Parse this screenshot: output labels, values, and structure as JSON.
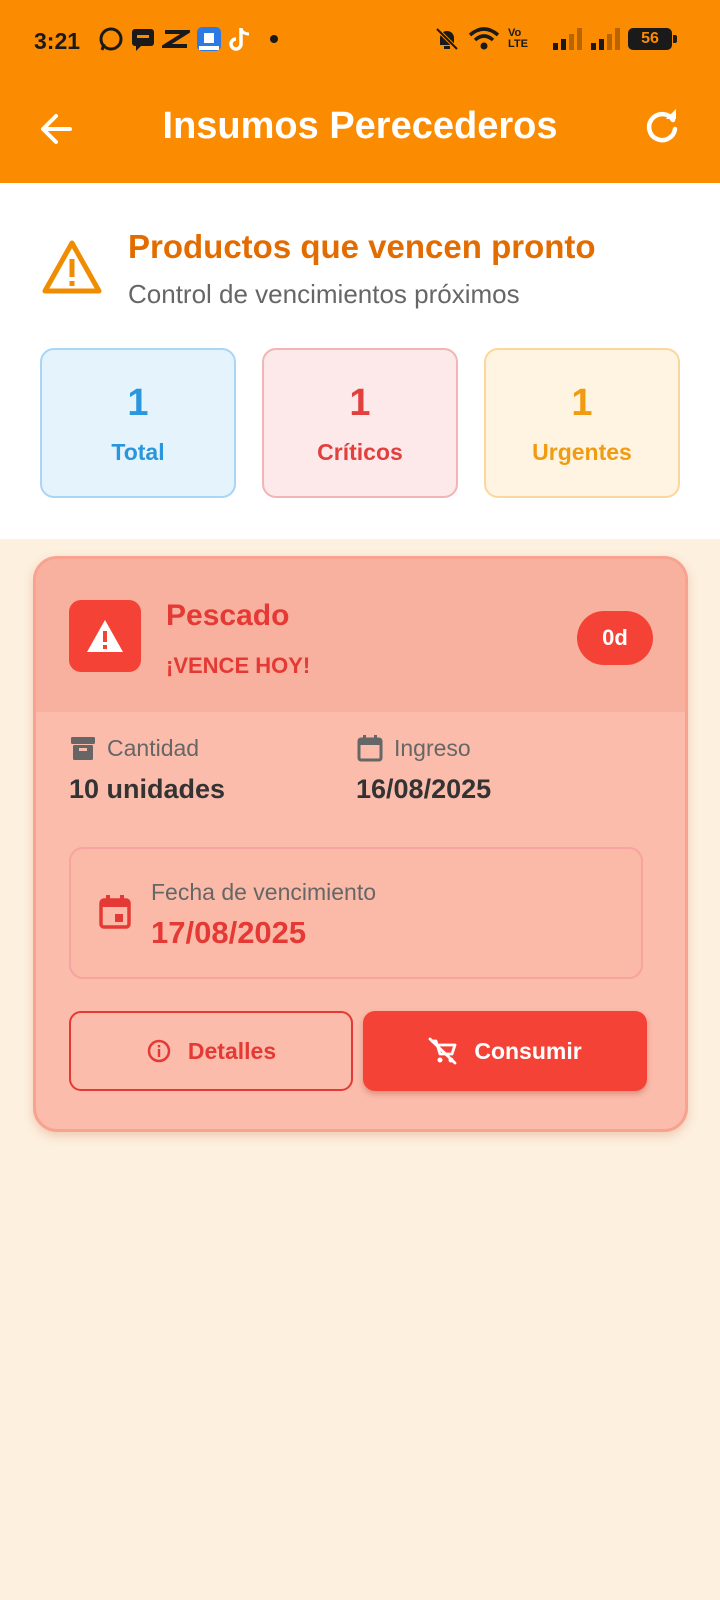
{
  "status_bar": {
    "time": "3:21",
    "network_label": "Vo LTE",
    "battery": "56",
    "app_icons": [
      "whatsapp-icon",
      "messenger-icon",
      "capcut-icon",
      "app-icon",
      "tiktok-icon"
    ]
  },
  "appbar": {
    "title": "Insumos Perecederos",
    "back_icon": "arrow-left-icon",
    "refresh_icon": "refresh-icon"
  },
  "summary": {
    "title": "Productos que vencen pronto",
    "subtitle": "Control de vencimientos próximos",
    "stats": [
      {
        "value": "1",
        "label": "Total",
        "color": "#2a96de"
      },
      {
        "value": "1",
        "label": "Críticos",
        "color": "#e2403c"
      },
      {
        "value": "1",
        "label": "Urgentes",
        "color": "#f09c12"
      }
    ]
  },
  "item": {
    "name": "Pescado",
    "status": "¡VENCE HOY!",
    "days_left": "0d",
    "quantity_label": "Cantidad",
    "quantity_value": "10 unidades",
    "entry_label": "Ingreso",
    "entry_value": "16/08/2025",
    "expiry_label": "Fecha de vencimiento",
    "expiry_value": "17/08/2025",
    "details_button": "Detalles",
    "consume_button": "Consumir"
  },
  "colors": {
    "primary": "#fb8b00",
    "danger": "#f44336",
    "background": "#fdf0de"
  }
}
